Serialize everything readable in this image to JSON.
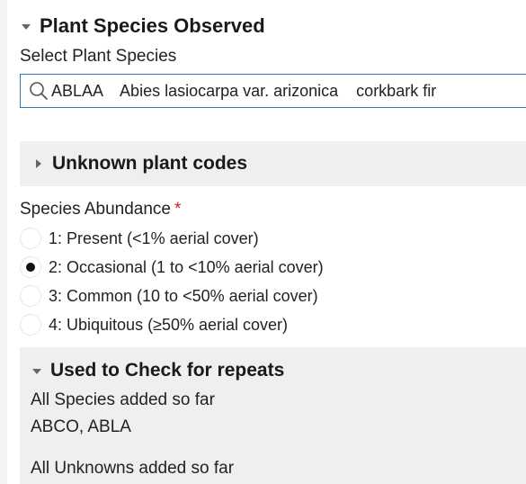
{
  "plant_species_section": {
    "title": "Plant Species Observed",
    "select_label": "Select Plant Species",
    "search_value": "ABLAA    Abies lasiocarpa var. arizonica    corkbark fir"
  },
  "unknown_section": {
    "title": "Unknown plant codes"
  },
  "abundance": {
    "label": "Species Abundance",
    "required_mark": "*",
    "selected_index": 1,
    "options": [
      {
        "label": "1: Present (<1% aerial cover)"
      },
      {
        "label": "2: Occasional (1 to <10% aerial cover)"
      },
      {
        "label": "3: Common (10 to <50% aerial cover)"
      },
      {
        "label": "4: Ubiquitous (≥50% aerial cover)"
      }
    ]
  },
  "repeats_section": {
    "title": "Used to Check for repeats",
    "species_label": "All Species added so far",
    "species_value": "ABCO, ABLA",
    "unknowns_label": "All Unknowns added so far"
  }
}
